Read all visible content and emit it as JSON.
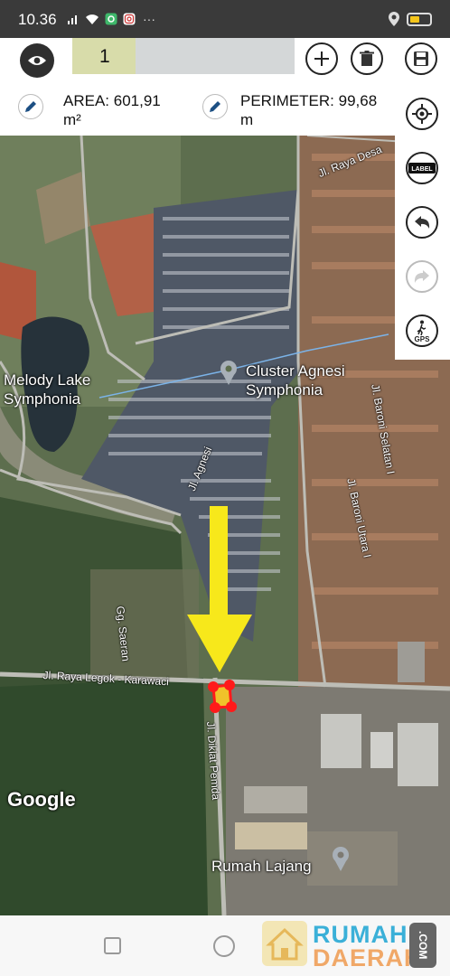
{
  "status_bar": {
    "time": "10.36",
    "overflow": "···",
    "icons": [
      "signal-icon",
      "wifi-icon",
      "app-notification-icon",
      "instagram-icon",
      "location-icon",
      "battery-icon"
    ]
  },
  "toolbar": {
    "name_value": "1",
    "buttons": [
      "visibility-toggle",
      "add",
      "delete",
      "save"
    ],
    "area_text": "AREA: 601,91 m²",
    "perimeter_text": "PERIMETER: 99,68 m"
  },
  "side_panel": {
    "label_button": "LABEL",
    "gps_button": "GPS",
    "buttons": [
      "locate",
      "label",
      "undo",
      "redo",
      "gps"
    ]
  },
  "map": {
    "places": {
      "melody_lake": "Melody Lake\nSymphonia",
      "cluster_agnesi": "Cluster Agnesi\nSymphonia",
      "rumah_lajang": "Rumah Lajang"
    },
    "roads": {
      "raya_desa": "Jl. Raya Desa",
      "agnesi": "Jl. Agnesi",
      "baroni_selatan": "Jl. Baroni Selatan I",
      "baroni_utara": "Jl. Baroni Utara I",
      "saeran": "Gg. Saeran",
      "legok": "Jl. Raya Legok - Karawaci",
      "diklat": "Jl. Diklat Pemda"
    },
    "attribution": "Google",
    "colors": {
      "marker": "#ff1a1a",
      "arrow": "#f7e81b"
    }
  },
  "watermark": {
    "line1": "RUMAH",
    "line2": "DAERAH",
    "com": ".COM"
  }
}
